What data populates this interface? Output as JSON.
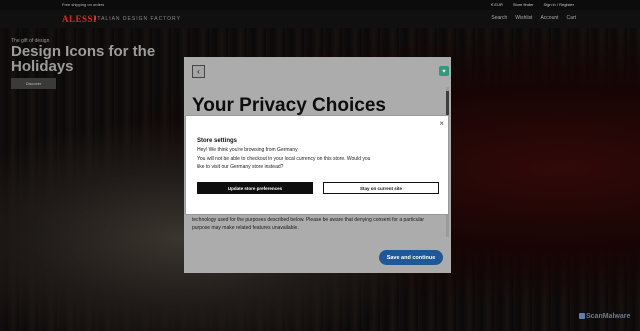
{
  "topbar": {
    "promo": "Free shipping on orders",
    "links": [
      "€ EUR",
      "Store finder",
      "Sign in / Register"
    ]
  },
  "header": {
    "logo": "ALESSI",
    "tagline": "ITALIAN DESIGN FACTORY",
    "icons": [
      "Search",
      "Wishlist",
      "Account",
      "Cart"
    ]
  },
  "hero": {
    "eyebrow": "The gift of design",
    "title": "Design Icons for the Holidays",
    "cta": "Discover"
  },
  "privacy_modal": {
    "title": "Your Privacy Choices",
    "body": "technology used for the purposes described below. Please be aware that denying consent for a particular purpose may make related features unavailable.",
    "save_label": "Save and continue"
  },
  "store_dialog": {
    "title": "Store settings",
    "line1": "Hey! We think you're browsing from Germany",
    "line2": "You will not be able to checkout in your local currency on this store. Would you like to visit our Germany store instead?",
    "update_label": "Update store preferences",
    "stay_label": "Stay on current site",
    "close_glyph": "×"
  },
  "watermark": "ScanMalware",
  "colors": {
    "brand": "#e2262c",
    "save_button": "#1f5797",
    "modal_bg": "#acacac"
  }
}
